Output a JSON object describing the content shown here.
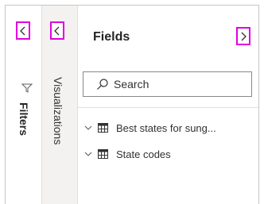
{
  "filters_pane": {
    "label": "Filters",
    "collapse_icon": "chevron-left-icon",
    "filter_icon": "funnel-icon"
  },
  "visualizations_pane": {
    "label": "Visualizations",
    "collapse_icon": "chevron-left-icon"
  },
  "fields_pane": {
    "title": "Fields",
    "expand_icon": "chevron-right-icon",
    "search": {
      "placeholder": "Search",
      "value": ""
    },
    "tables": [
      {
        "label": "Best states for sung...",
        "icon": "table-icon",
        "expanded": false
      },
      {
        "label": "State codes",
        "icon": "table-icon",
        "expanded": false
      }
    ]
  },
  "colors": {
    "highlight": "#e000e0",
    "pane_gray": "#f3f2f1",
    "border": "#c8c6c4"
  }
}
